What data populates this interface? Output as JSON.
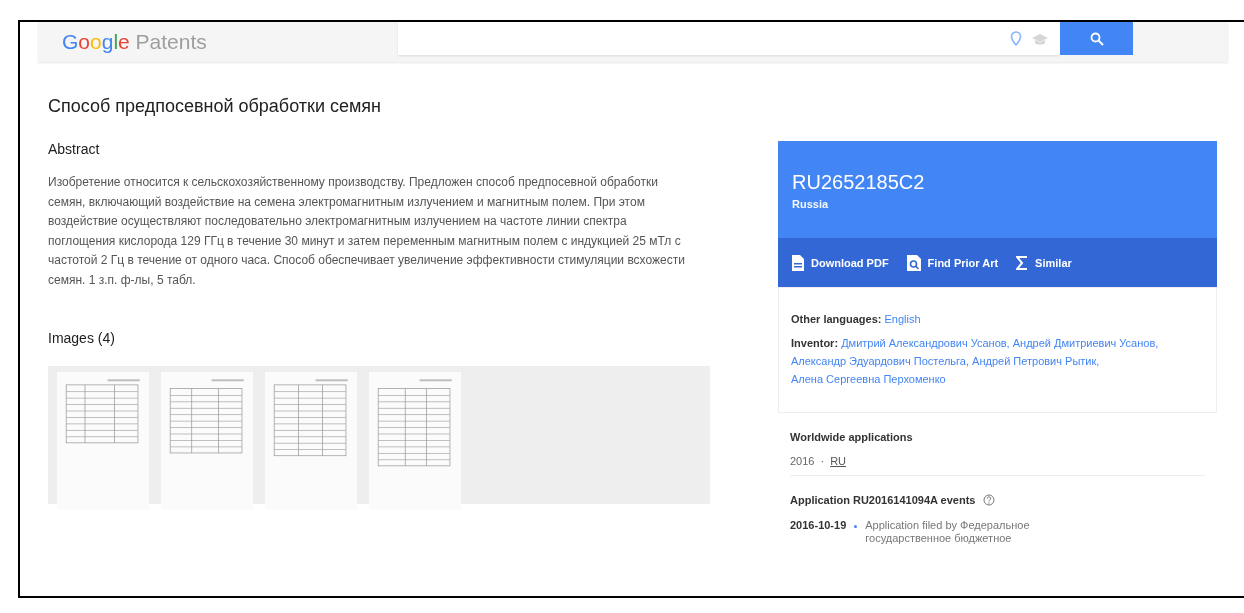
{
  "header": {
    "logo": {
      "brand": "Google",
      "product": "Patents"
    },
    "search": {
      "kind": "field"
    }
  },
  "title": "Способ предпосевной обработки семян",
  "abstract": {
    "heading": "Abstract",
    "text": "Изобретение относится к сельскохозяйственному производству. Предложен способ предпосевной обработки семян, включающий воздействие на семена электромагнитным излучением и магнитным полем. При этом воздействие осуществляют последовательно электромагнитным излучением на частоте линии спектра поглощения кислорода 129 ГГц в течение 30 минут и затем переменным магнитным полем с индукцией 25 мТл с частотой 2 Гц в течение от одного часа. Способ обеспечивает увеличение эффективности стимуляции всхожести семян. 1 з.п. ф-лы, 5 табл."
  },
  "images": {
    "heading": "Images (4)"
  },
  "summary": {
    "number": "RU2652185C2",
    "country": "Russia",
    "actions": [
      {
        "kind": "pdf",
        "label": "Download PDF"
      },
      {
        "kind": "prior-art",
        "label": "Find Prior Art"
      },
      {
        "kind": "similar",
        "label": "Similar"
      }
    ]
  },
  "other_languages": {
    "label": "Other languages:",
    "links": [
      "English"
    ]
  },
  "inventor": {
    "label": "Inventor:",
    "links": [
      "Дмитрий Александрович Усанов,",
      "Андрей Дмитриевич Усанов,",
      "Александр Эдуардович Постельга,",
      "Андрей Петрович Рытик,",
      "Алена Сергеевна Перхоменко"
    ]
  },
  "worldwide": {
    "heading": "Worldwide applications",
    "year": "2016",
    "separator": "·",
    "country": "RU"
  },
  "events": {
    "heading": "Application RU2016141094A events",
    "items": [
      {
        "date": "2016-10-19",
        "text": "Application filed by Федеральное государственное бюджетное"
      }
    ]
  }
}
